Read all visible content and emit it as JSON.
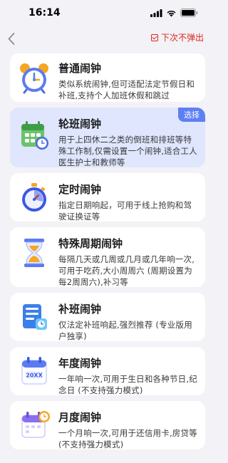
{
  "status_bar": {
    "time": "16:14"
  },
  "nav": {
    "dont_show_label": "下次不弹出"
  },
  "cards": [
    {
      "title": "普通闹钟",
      "desc": "类似系统闹钟,但可适配法定节假日和补班,支持个人加班休假和跳过",
      "icon": "alarm-clock-icon"
    },
    {
      "title": "轮班闹钟",
      "desc": "用于上四休二之类的倒班和排班等特殊工作制,仅需设置一个闹钟,适合工人医生护士和教师等",
      "icon": "shift-calendar-icon",
      "badge": "选择",
      "selected": true
    },
    {
      "title": "定时闹钟",
      "desc": "指定日期响起，可用于线上抢购和驾驶证换证等",
      "icon": "stopwatch-icon"
    },
    {
      "title": "特殊周期闹钟",
      "desc": "每隔几天或几周或几月或几年响一次,可用于吃药,大小周周六 (周期设置为每2周周六),补习等",
      "icon": "hourglass-icon"
    },
    {
      "title": "补班闹钟",
      "desc": "仅法定补班响起,强烈推荐 (专业版用户独享)",
      "icon": "makeup-work-icon"
    },
    {
      "title": "年度闹钟",
      "desc": "一年响一次,可用于生日和各种节日,纪念日 (不支持强力模式)",
      "icon": "yearly-calendar-icon",
      "icon_text": "20XX"
    },
    {
      "title": "月度闹钟",
      "desc": "一个月响一次,可用于还信用卡,房贷等 (不支持强力模式)",
      "icon": "monthly-calendar-icon"
    }
  ]
}
